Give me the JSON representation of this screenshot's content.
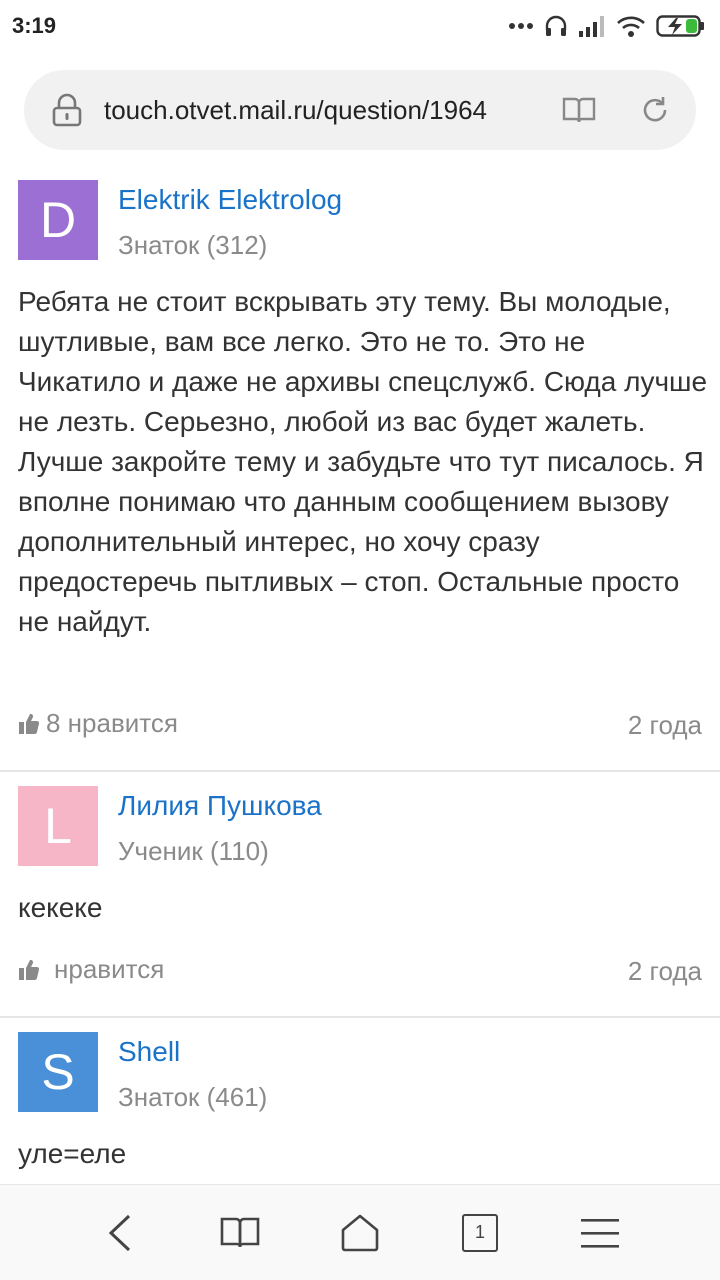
{
  "status": {
    "time": "3:19"
  },
  "browser": {
    "url": "touch.otvet.mail.ru/question/1964"
  },
  "answers": [
    {
      "avatar_letter": "D",
      "avatar_color": "#9b6fd4",
      "author": "Elektrik Elektrolog",
      "rank": "Знаток (312)",
      "text": "Ребята не стоит вскрывать эту тему. Вы молодые, шутливые, вам все легко. Это не то. Это не Чикатило и даже не архивы спецслужб. Сюда лучше не лезть. Серьезно, любой из вас будет жалеть. Лучше закройте тему и забудьте что тут писалось. Я вполне понимаю что данным сообщением вызову дополнительный интерес, но хочу сразу предостеречь пытливых – стоп. Остальные просто не найдут.",
      "likes": "8 нравится",
      "age": "2 года"
    },
    {
      "avatar_letter": "L",
      "avatar_color": "#f7b5c8",
      "author": "Лилия Пушкова",
      "rank": "Ученик (110)",
      "text": "кекеке",
      "likes": "нравится",
      "age": "2 года"
    },
    {
      "avatar_letter": "S",
      "avatar_color": "#4a90d9",
      "author": "Shell",
      "rank": "Знаток (461)",
      "text": "уле=еле"
    }
  ],
  "navbar": {
    "tab_count": "1"
  }
}
